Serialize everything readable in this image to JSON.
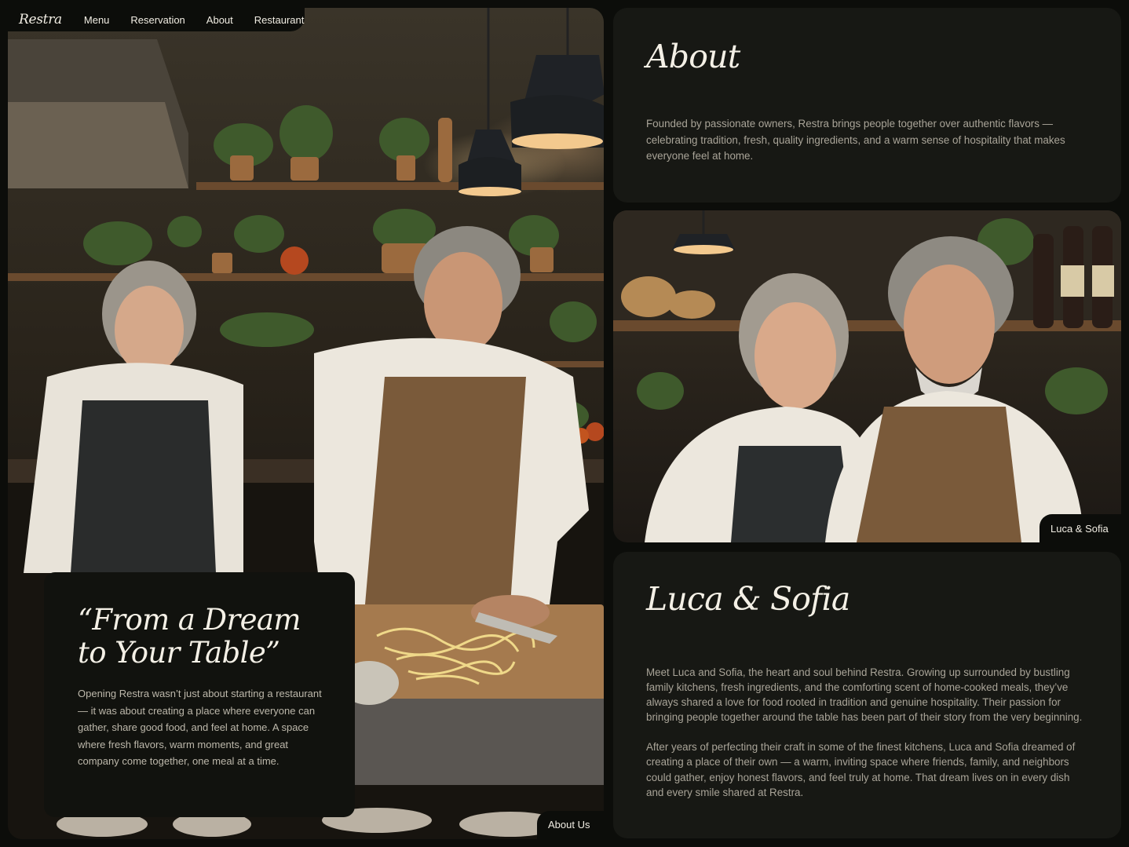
{
  "nav": {
    "logo": "Restra",
    "links": [
      "Menu",
      "Reservation",
      "About",
      "Restaurant"
    ]
  },
  "hero": {
    "image_alt": "Two chefs preparing fresh pasta in a warm kitchen",
    "quote_title": "“From a Dream to Your Table”",
    "quote_body": "Opening Restra wasn’t just about starting a restaurant — it was about creating a place where everyone can gather, share good food, and feel at home. A space where fresh flavors, warm moments, and great company come together, one meal at a time.",
    "chip": "About Us"
  },
  "about": {
    "title": "About",
    "text": "Founded by passionate owners, Restra brings people together over authentic flavors — celebrating tradition, fresh, quality ingredients, and a warm sense of hospitality that makes everyone feel at home."
  },
  "owners_photo": {
    "alt": "Portrait of the two owners smiling in their kitchen",
    "chip": "Luca & Sofia"
  },
  "story": {
    "title": "Luca & Sofia",
    "paragraph1": "Meet Luca and Sofia, the heart and soul behind Restra. Growing up surrounded by bustling family kitchens, fresh ingredients, and the comforting scent of home-cooked meals, they’ve always shared a love for food rooted in tradition and genuine hospitality. Their passion for bringing people together around the table has been part of their story from the very beginning.",
    "paragraph2": "After years of perfecting their craft in some of the finest kitchens, Luca and Sofia dreamed of creating a place of their own — a warm, inviting space where friends, family, and neighbors could gather, enjoy honest flavors, and feel truly at home. That dream lives on in every dish and every smile shared at Restra."
  },
  "colors": {
    "background": "#0c0d0a",
    "panel": "#171814",
    "heading": "#f4f0e6",
    "body_text": "#a9a498"
  }
}
